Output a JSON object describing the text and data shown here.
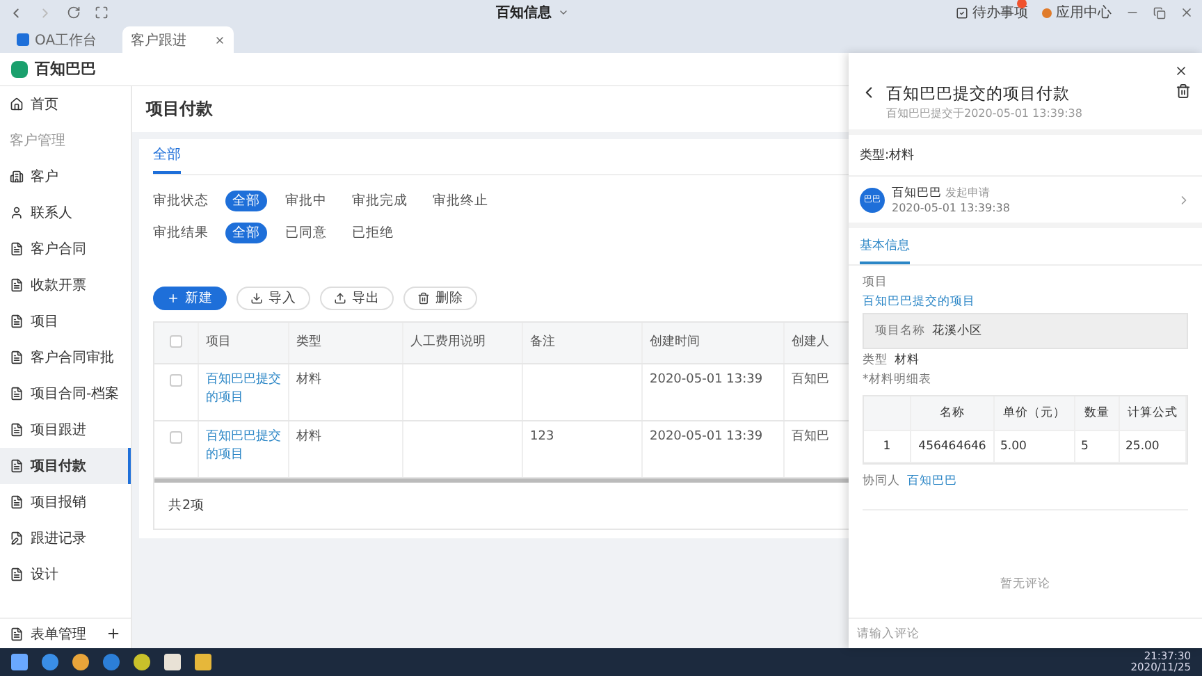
{
  "window": {
    "title": "百知信息",
    "todo": "待办事项",
    "app_center": "应用中心"
  },
  "browser_tabs": [
    {
      "label": "OA工作台",
      "selected": false
    },
    {
      "label": "客户跟进",
      "selected": true
    }
  ],
  "app": {
    "name": "百知巴巴"
  },
  "sidebar": {
    "items": [
      {
        "kind": "item",
        "label": "首页",
        "selected": false
      },
      {
        "kind": "section",
        "label": "客户管理"
      },
      {
        "kind": "item",
        "label": "客户",
        "selected": false
      },
      {
        "kind": "item",
        "label": "联系人",
        "selected": false
      },
      {
        "kind": "item",
        "label": "客户合同",
        "selected": false
      },
      {
        "kind": "item",
        "label": "收款开票",
        "selected": false
      },
      {
        "kind": "item",
        "label": "项目",
        "selected": false
      },
      {
        "kind": "item",
        "label": "客户合同审批",
        "selected": false
      },
      {
        "kind": "item",
        "label": "项目合同-档案",
        "selected": false
      },
      {
        "kind": "item",
        "label": "项目跟进",
        "selected": false
      },
      {
        "kind": "item",
        "label": "项目付款",
        "selected": true
      },
      {
        "kind": "item",
        "label": "项目报销",
        "selected": false
      },
      {
        "kind": "item",
        "label": "跟进记录",
        "selected": false
      },
      {
        "kind": "item",
        "label": "设计",
        "selected": false
      }
    ],
    "footer": "表单管理"
  },
  "page": {
    "title": "项目付款",
    "tabs": [
      {
        "label": "全部",
        "selected": true
      }
    ],
    "filters": [
      {
        "label": "审批状态",
        "options": [
          {
            "label": "全部",
            "selected": true
          },
          {
            "label": "审批中",
            "selected": false
          },
          {
            "label": "审批完成",
            "selected": false
          },
          {
            "label": "审批终止",
            "selected": false
          }
        ]
      },
      {
        "label": "审批结果",
        "options": [
          {
            "label": "全部",
            "selected": true
          },
          {
            "label": "已同意",
            "selected": false
          },
          {
            "label": "已拒绝",
            "selected": false
          }
        ]
      }
    ],
    "actions": [
      {
        "kind": "primary",
        "label": "新建"
      },
      {
        "kind": "plain",
        "label": "导入"
      },
      {
        "kind": "plain",
        "label": "导出"
      },
      {
        "kind": "plain",
        "label": "删除"
      }
    ],
    "table": {
      "all_checked": false,
      "columns": [
        "项目",
        "类型",
        "人工费用说明",
        "备注",
        "创建时间",
        "创建人"
      ],
      "rows": [
        {
          "checked": false,
          "cells": [
            "百知巴巴提交的项目",
            "材料",
            "",
            "",
            "2020-05-01 13:39",
            "百知巴"
          ]
        },
        {
          "checked": false,
          "cells": [
            "百知巴巴提交的项目",
            "材料",
            "",
            "123",
            "2020-05-01 13:39",
            "百知巴"
          ]
        }
      ]
    },
    "total": "共2项"
  },
  "drawer": {
    "title": "百知巴巴提交的项目付款",
    "subtitle": "百知巴巴提交于2020-05-01 13:39:38",
    "type": "类型:材料",
    "applicant": {
      "avatar": "巴巴",
      "name": "百知巴巴",
      "action": "发起申请",
      "time": "2020-05-01 13:39:38"
    },
    "tabs": [
      {
        "label": "基本信息",
        "selected": true
      }
    ],
    "project_label": "项目",
    "project_value": "百知巴巴提交的项目",
    "card": {
      "label": "项目名称",
      "value": "花溪小区"
    },
    "type_label": "类型",
    "type_value": "材料",
    "detail_label": "*材料明细表",
    "detail_table": {
      "columns": [
        "",
        "名称",
        "单价（元）",
        "数量",
        "计算公式"
      ],
      "rows": [
        [
          "1",
          "456464646",
          "5.00",
          "5",
          "25.00"
        ]
      ]
    },
    "collaborator_label": "协同人",
    "collaborator": "百知巴巴",
    "empty_comments": "暂无评论",
    "comment_placeholder": "请输入评论"
  },
  "taskbar": {
    "time": "21:37:30",
    "date": "2020/11/25"
  }
}
